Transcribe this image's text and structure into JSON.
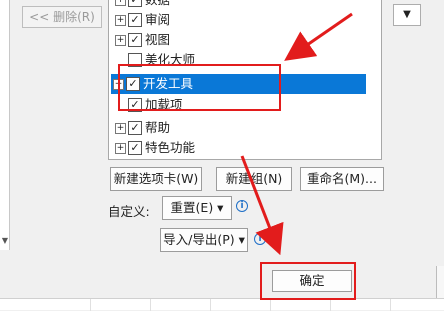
{
  "remove_button": "<< 删除(R)",
  "tree_items": [
    {
      "label": "数据",
      "expander": "+",
      "checked": "✓",
      "child": false,
      "selected": false
    },
    {
      "label": "审阅",
      "expander": "+",
      "checked": "✓",
      "child": false,
      "selected": false
    },
    {
      "label": "视图",
      "expander": "+",
      "checked": "✓",
      "child": false,
      "selected": false
    },
    {
      "label": "美化大师",
      "expander": "",
      "checked": "",
      "child": false,
      "selected": false
    },
    {
      "label": "开发工具",
      "expander": "+",
      "checked": "✓",
      "child": false,
      "selected": true
    },
    {
      "label": "加载项",
      "expander": "",
      "checked": "✓",
      "child": true,
      "selected": false
    },
    {
      "label": "帮助",
      "expander": "+",
      "checked": "✓",
      "child": false,
      "selected": false
    },
    {
      "label": "特色功能",
      "expander": "+",
      "checked": "✓",
      "child": false,
      "selected": false
    }
  ],
  "dropdown_arrow": "▼",
  "new_tab_button": "新建选项卡(W)",
  "new_group_button": "新建组(N)",
  "rename_button": "重命名(M)...",
  "customize_label": "自定义:",
  "reset_button": "重置(E) ▾",
  "import_export_button": "导入/导出(P) ▾",
  "info_symbol": "i",
  "ok_button": "确定",
  "colors": {
    "selection": "#0a78d7",
    "annotation": "#e21c1c"
  }
}
